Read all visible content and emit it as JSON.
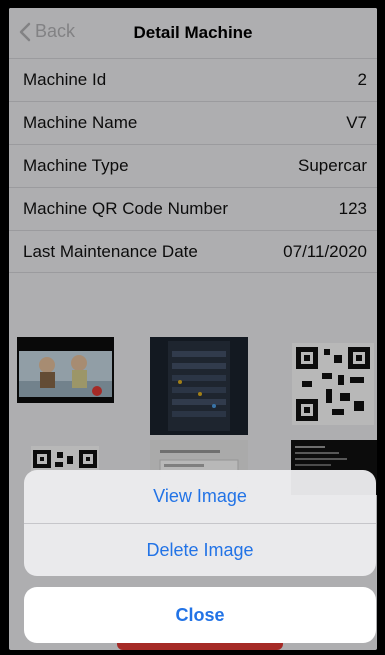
{
  "nav": {
    "back_label": "Back",
    "title": "Detail Machine"
  },
  "details": [
    {
      "label": "Machine Id",
      "value": "2"
    },
    {
      "label": "Machine Name",
      "value": "V7"
    },
    {
      "label": "Machine Type",
      "value": "Supercar"
    },
    {
      "label": "Machine QR Code Number",
      "value": "123"
    },
    {
      "label": "Last Maintenance Date",
      "value": "07/11/2020"
    }
  ],
  "thumbnails": [
    {
      "icon": "cartoon-image-icon"
    },
    {
      "icon": "server-rack-photo-icon"
    },
    {
      "icon": "qr-code-icon"
    },
    {
      "icon": "qr-code-icon"
    },
    {
      "icon": "downloads-screenshot-icon"
    },
    {
      "icon": "terminal-screenshot-icon"
    }
  ],
  "action_sheet": {
    "view_label": "View Image",
    "delete_label": "Delete Image",
    "close_label": "Close"
  },
  "colors": {
    "accent": "#2273e6",
    "background": "#f2f2f4",
    "destructive": "#e53b35"
  }
}
